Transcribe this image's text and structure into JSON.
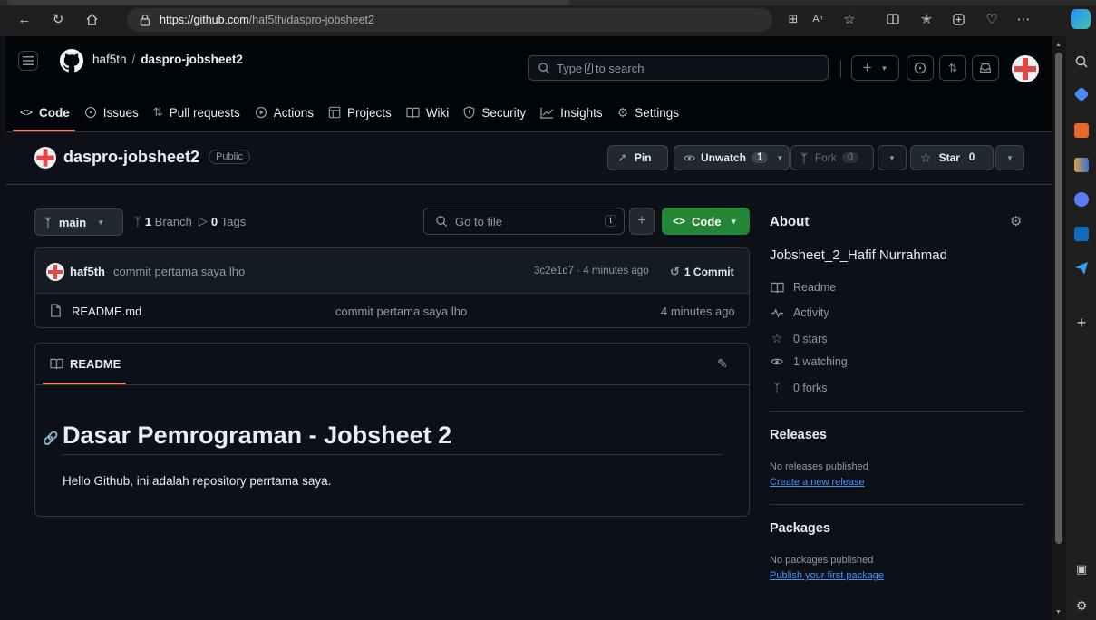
{
  "browser": {
    "url_scheme_host": "https://github.com",
    "url_path": "/haf5th/daspro-jobsheet2"
  },
  "header": {
    "owner": "haf5th",
    "separator": "/",
    "repo": "daspro-jobsheet2",
    "search_prefix": "Type",
    "search_key": "/",
    "search_suffix": "to search",
    "new_button": "+"
  },
  "nav": {
    "tabs": [
      {
        "label": "Code",
        "icon": "code-icon"
      },
      {
        "label": "Issues",
        "icon": "issue-icon"
      },
      {
        "label": "Pull requests",
        "icon": "pull-request-icon"
      },
      {
        "label": "Actions",
        "icon": "play-icon"
      },
      {
        "label": "Projects",
        "icon": "table-icon"
      },
      {
        "label": "Wiki",
        "icon": "book-icon"
      },
      {
        "label": "Security",
        "icon": "shield-icon"
      },
      {
        "label": "Insights",
        "icon": "graph-icon"
      },
      {
        "label": "Settings",
        "icon": "gear-icon"
      }
    ]
  },
  "repo": {
    "name": "daspro-jobsheet2",
    "visibility": "Public",
    "pin": "Pin",
    "unwatch": "Unwatch",
    "watch_count": "1",
    "fork": "Fork",
    "fork_count": "0",
    "star": "Star",
    "star_count": "0"
  },
  "toolbar": {
    "branch": "main",
    "branch_count": "1",
    "branch_label": "Branch",
    "tag_count": "0",
    "tag_label": "Tags",
    "go_to_file": "Go to file",
    "go_to_file_key": "t",
    "code_button": "Code"
  },
  "commit": {
    "author": "haf5th",
    "message": "commit pertama saya lho",
    "hash_time": "3c2e1d7 · 4 minutes ago",
    "count_label": "1 Commit"
  },
  "files": [
    {
      "name": "README.md",
      "message": "commit pertama saya lho",
      "time": "4 minutes ago"
    }
  ],
  "readme": {
    "tab": "README",
    "heading": "Dasar Pemrograman - Jobsheet 2",
    "paragraph": "Hello Github, ini adalah repository perrtama saya."
  },
  "about": {
    "title": "About",
    "description": "Jobsheet_2_Hafif Nurrahmad",
    "items": [
      "Readme",
      "Activity",
      "0 stars",
      "1 watching",
      "0 forks"
    ]
  },
  "releases": {
    "title": "Releases",
    "empty": "No releases published",
    "link": "Create a new release"
  },
  "packages": {
    "title": "Packages",
    "empty": "No packages published",
    "link": "Publish your first package"
  },
  "colors": {
    "bg": "#0d1117",
    "header_bg": "#010409",
    "accent_tab": "#f78166",
    "green": "#238636",
    "link": "#4493f8"
  }
}
